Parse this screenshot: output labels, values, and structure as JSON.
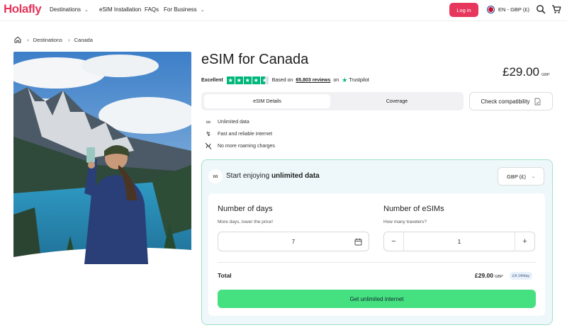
{
  "header": {
    "logo_text": "Holafly",
    "nav": [
      {
        "label": "Destinations",
        "has_dropdown": true
      },
      {
        "label": "eSIM Installation",
        "has_dropdown": false
      },
      {
        "label": "FAQs",
        "has_dropdown": false
      },
      {
        "label": "For Business",
        "has_dropdown": true
      }
    ],
    "login_label": "Log in",
    "language_label": "EN - GBP (£)",
    "icons": [
      "search-icon",
      "cart-icon"
    ],
    "brand_color": "#e6365c"
  },
  "breadcrumb": {
    "items": [
      "Destinations",
      "Canada"
    ],
    "home_icon": "home-icon"
  },
  "product": {
    "title": "eSIM for Canada",
    "rating_label": "Excellent",
    "stars": 4.5,
    "reviews_prefix": "Based on",
    "reviews_link": "65,803 reviews",
    "reviews_on": "on",
    "trustpilot": "Trustpilot",
    "price": "£29.00",
    "price_currency": "GBP"
  },
  "tabs": [
    {
      "label": "eSIM Details",
      "active": true
    },
    {
      "label": "Coverage",
      "active": false
    }
  ],
  "check_compat_label": "Check compatibility",
  "features": [
    {
      "icon": "infinity-icon",
      "label": "Unlimited data"
    },
    {
      "icon": "bolt-icon",
      "label": "Fast and reliable internet"
    },
    {
      "icon": "no-roaming-icon",
      "label": "No more roaming charges"
    }
  ],
  "plan": {
    "heading_prefix": "Start enjoying",
    "heading_bold": "unlimited data",
    "currency_select": "GBP (£)",
    "days": {
      "title": "Number of days",
      "subtitle": "More days, lower the price!",
      "value": "7"
    },
    "esims": {
      "title": "Number of eSIMs",
      "subtitle": "How many travelers?",
      "value": "1",
      "minus": "−",
      "plus": "+"
    },
    "total_label": "Total",
    "total_price": "£29.00",
    "total_currency": "GBP",
    "per_day": "£4.14/day",
    "buy_label": "Get unlimited internet",
    "accent_color": "#45e07f"
  }
}
